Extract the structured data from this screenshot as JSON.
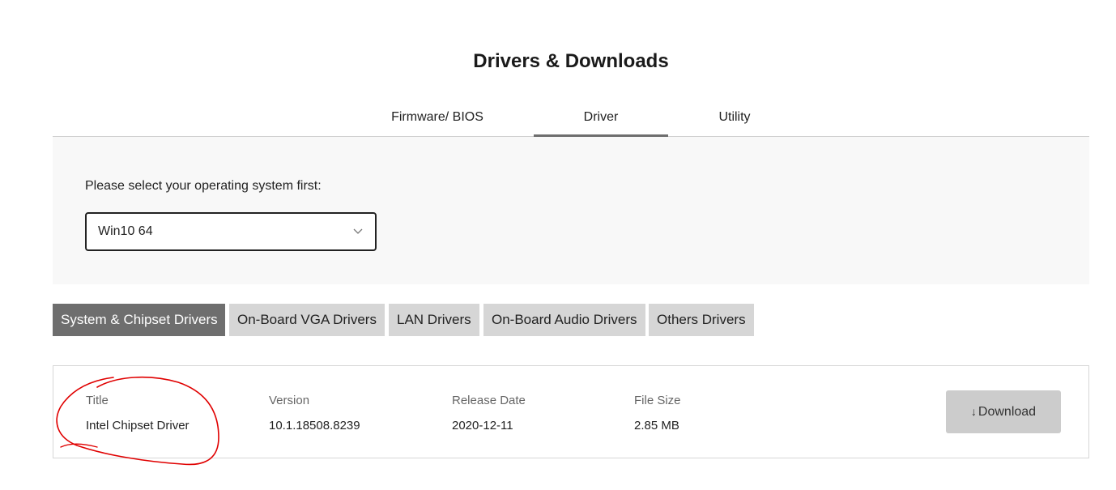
{
  "page_title": "Drivers & Downloads",
  "tabs": [
    {
      "label": "Firmware/ BIOS",
      "active": false
    },
    {
      "label": "Driver",
      "active": true
    },
    {
      "label": "Utility",
      "active": false
    }
  ],
  "os_select": {
    "label": "Please select your operating system first:",
    "value": "Win10 64"
  },
  "categories": [
    {
      "label": "System & Chipset Drivers",
      "active": true
    },
    {
      "label": "On-Board VGA Drivers",
      "active": false
    },
    {
      "label": "LAN Drivers",
      "active": false
    },
    {
      "label": "On-Board Audio Drivers",
      "active": false
    },
    {
      "label": "Others Drivers",
      "active": false
    }
  ],
  "driver_table": {
    "headers": {
      "title": "Title",
      "version": "Version",
      "release_date": "Release Date",
      "file_size": "File Size"
    },
    "rows": [
      {
        "title": "Intel Chipset Driver",
        "version": "10.1.18508.8239",
        "release_date": "2020-12-11",
        "file_size": "2.85 MB",
        "download_label": "Download",
        "download_icon": "download-arrow-icon"
      }
    ]
  },
  "colors": {
    "active_tab_underline": "#6e6e6e",
    "active_category": "#6e6e6e",
    "inactive_category": "#d6d6d6",
    "download_button": "#cccccc",
    "annotation_stroke": "#e00000"
  }
}
